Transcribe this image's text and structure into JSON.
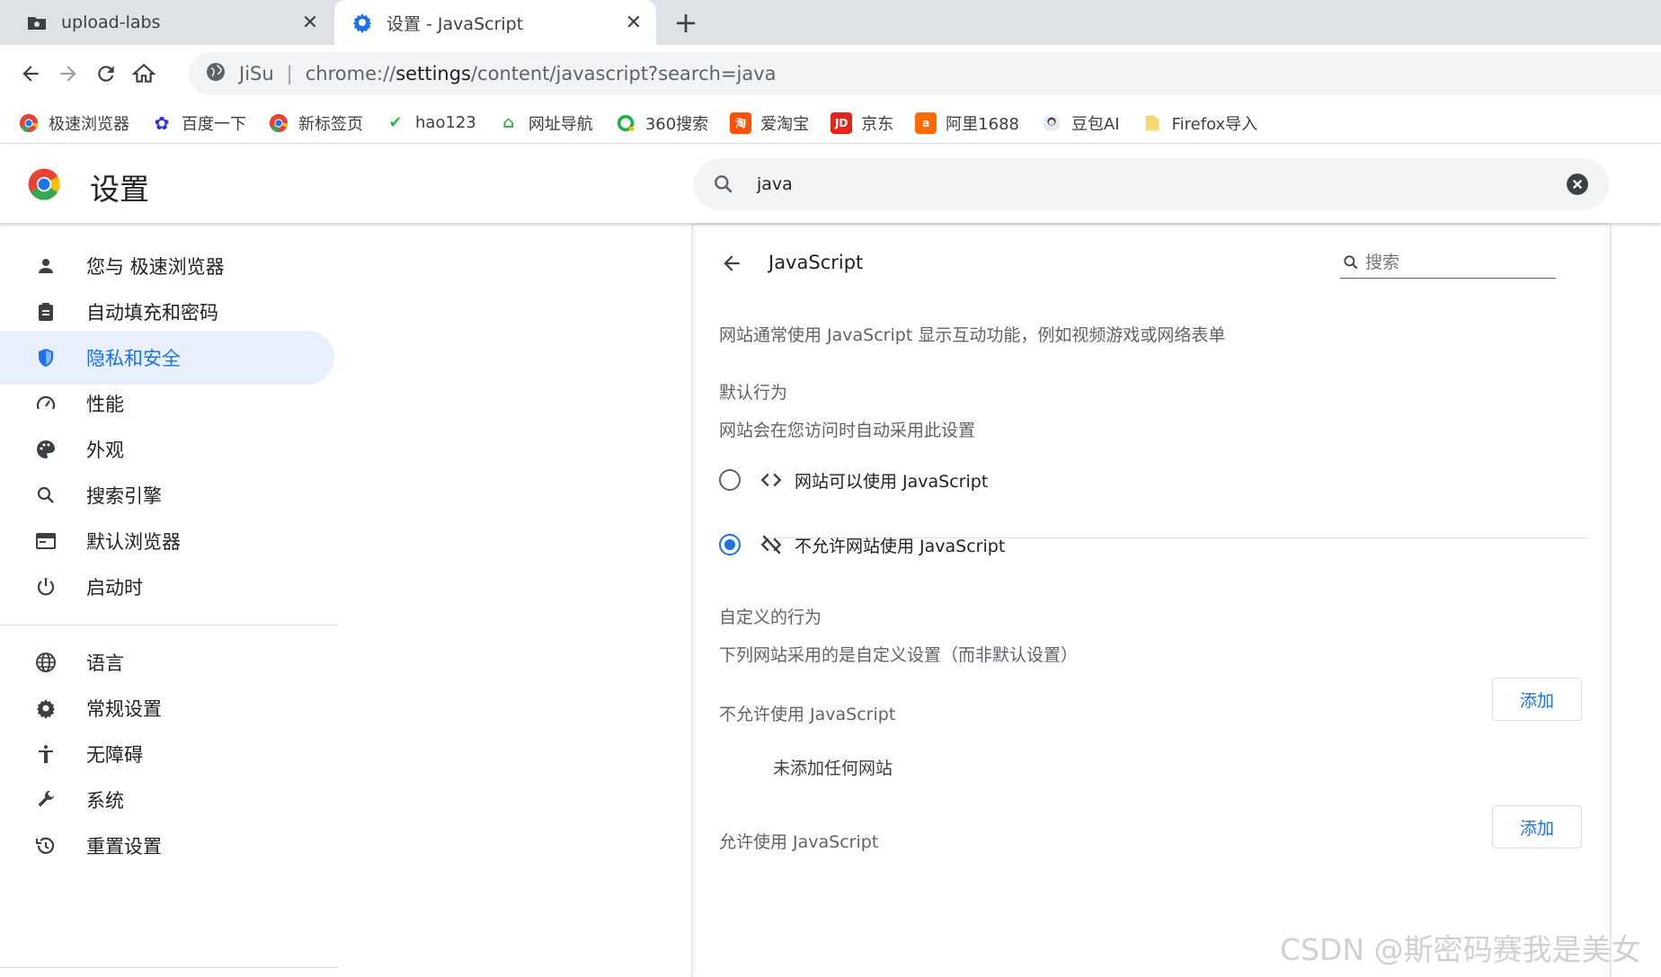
{
  "tabs": [
    {
      "title": "upload-labs",
      "icon": "folder-icon",
      "active": false
    },
    {
      "title": "设置 - JavaScript",
      "icon": "gear-icon",
      "active": true
    }
  ],
  "toolbar": {
    "site_name": "JiSu",
    "url_prefix": "chrome://",
    "url_host": "settings",
    "url_path": "/content/javascript?search=java"
  },
  "bookmarks": [
    {
      "label": "极速浏览器",
      "icon": "chrome-icon",
      "color": "#e94235"
    },
    {
      "label": "百度一下",
      "icon": "baidu-icon",
      "color": "#2932e1"
    },
    {
      "label": "新标签页",
      "icon": "chrome-icon",
      "color": "#e94235"
    },
    {
      "label": "hao123",
      "icon": "hao123-icon",
      "color": "#3cb34a"
    },
    {
      "label": "网址导航",
      "icon": "2345-icon",
      "color": "#4caf50"
    },
    {
      "label": "360搜索",
      "icon": "360-icon",
      "color": "#1fb14f"
    },
    {
      "label": "爱淘宝",
      "icon": "taobao-icon",
      "color": "#ff5000"
    },
    {
      "label": "京东",
      "icon": "jd-icon",
      "color": "#e1251b"
    },
    {
      "label": "阿里1688",
      "icon": "alibaba-icon",
      "color": "#ff6a00"
    },
    {
      "label": "豆包AI",
      "icon": "doubao-icon",
      "color": "#6a7bd0"
    },
    {
      "label": "Firefox导入",
      "icon": "folder-icon",
      "color": "#f8d775"
    }
  ],
  "settings": {
    "title": "设置",
    "search_value": "java"
  },
  "sidebar": {
    "items": [
      {
        "label": "您与 极速浏览器",
        "icon": "person-icon"
      },
      {
        "label": "自动填充和密码",
        "icon": "clipboard-icon"
      },
      {
        "label": "隐私和安全",
        "icon": "shield-icon",
        "selected": true
      },
      {
        "label": "性能",
        "icon": "speedometer-icon"
      },
      {
        "label": "外观",
        "icon": "palette-icon"
      },
      {
        "label": "搜索引擎",
        "icon": "search-icon"
      },
      {
        "label": "默认浏览器",
        "icon": "browser-icon"
      },
      {
        "label": "启动时",
        "icon": "power-icon"
      },
      {
        "label": "语言",
        "icon": "globe-icon"
      },
      {
        "label": "常规设置",
        "icon": "gear-icon"
      },
      {
        "label": "无障碍",
        "icon": "accessibility-icon"
      },
      {
        "label": "系统",
        "icon": "wrench-icon"
      },
      {
        "label": "重置设置",
        "icon": "history-icon"
      }
    ]
  },
  "content": {
    "title": "JavaScript",
    "search_placeholder": "搜索",
    "description": "网站通常使用 JavaScript 显示互动功能，例如视频游戏或网络表单",
    "default_heading": "默认行为",
    "default_desc": "网站会在您访问时自动采用此设置",
    "option_allow": "网站可以使用 JavaScript",
    "option_block": "不允许网站使用 JavaScript",
    "selected_option": "block",
    "custom_heading": "自定义的行为",
    "custom_desc": "下列网站采用的是自定义设置（而非默认设置）",
    "block_section": "不允许使用 JavaScript",
    "add_label": "添加",
    "empty_text": "未添加任何网站",
    "allow_section": "允许使用 JavaScript"
  },
  "watermark": "CSDN @斯密码赛我是美女"
}
